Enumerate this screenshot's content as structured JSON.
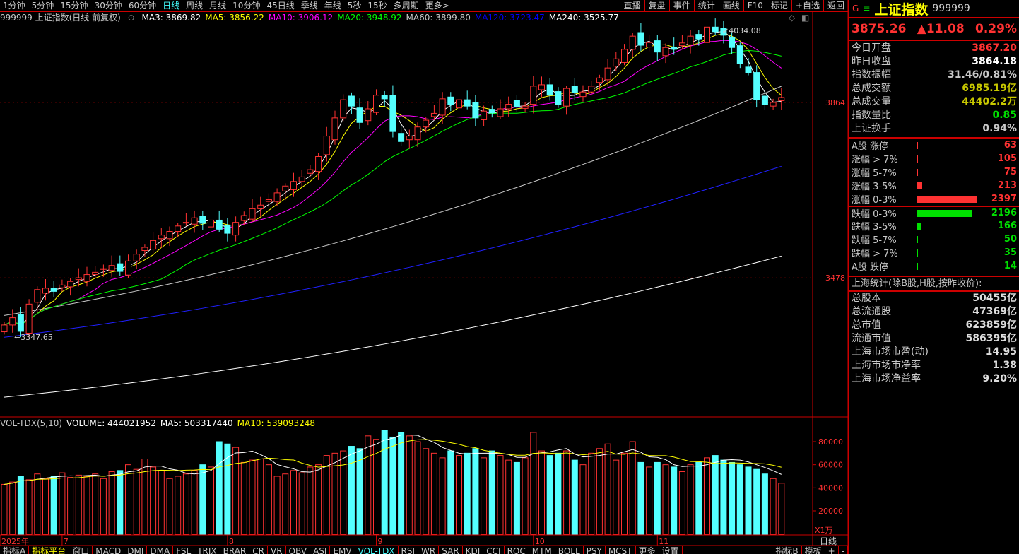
{
  "toolbar": {
    "periods": [
      "1分钟",
      "5分钟",
      "15分钟",
      "30分钟",
      "60分钟",
      "日线",
      "周线",
      "月线",
      "10分钟",
      "45日线",
      "季线",
      "年线",
      "5秒",
      "15秒",
      "多周期",
      "更多>"
    ],
    "active": "日线",
    "buttons": [
      "直播",
      "复盘",
      "事件",
      "统计",
      "画线",
      "F10",
      "标记",
      "+自选",
      "返回"
    ]
  },
  "ma_header": {
    "title": "999999 上证指数(日线 前复权)",
    "items": [
      {
        "label": "MA3: 3869.82",
        "color": "#ffffff"
      },
      {
        "label": "MA5: 3856.22",
        "color": "#ffff00"
      },
      {
        "label": "MA10: 3906.12",
        "color": "#ff00ff"
      },
      {
        "label": "MA20: 3948.92",
        "color": "#00ff00"
      },
      {
        "label": "MA60: 3899.80",
        "color": "#c8c8c8"
      },
      {
        "label": "MA120: 3723.47",
        "color": "#0000ff"
      },
      {
        "label": "MA240: 3525.77",
        "color": "#ffffff"
      }
    ]
  },
  "vol_header": {
    "items": [
      {
        "label": "VOL-TDX(5,10)",
        "color": "#c8c8c8"
      },
      {
        "label": "VOLUME: 444021952",
        "color": "#ffffff"
      },
      {
        "label": "MA5: 503317440",
        "color": "#ffffff"
      },
      {
        "label": "MA10: 539093248",
        "color": "#ffff00"
      }
    ]
  },
  "chart_data": {
    "type": "candlestick",
    "price_ticks": [
      3864,
      3478
    ],
    "high_label": "4034.08",
    "low_label": "3347.65",
    "vol_ticks": [
      80000,
      60000,
      40000,
      20000
    ],
    "vol_unit": "X1万",
    "x_labels": [
      {
        "i": 0,
        "t": "2025年"
      },
      {
        "i": 7,
        "t": "7"
      },
      {
        "i": 27,
        "t": "8"
      },
      {
        "i": 45,
        "t": "9"
      },
      {
        "i": 64,
        "t": "10"
      },
      {
        "i": 79,
        "t": "11"
      }
    ],
    "period_label": "日线",
    "closes": [
      3374,
      3390,
      3360,
      3420,
      3452,
      3455,
      3448,
      3462,
      3470,
      3478,
      3485,
      3490,
      3498,
      3505,
      3492,
      3515,
      3530,
      3545,
      3560,
      3572,
      3580,
      3592,
      3600,
      3610,
      3598,
      3605,
      3585,
      3576,
      3600,
      3615,
      3630,
      3638,
      3650,
      3665,
      3680,
      3690,
      3700,
      3716,
      3745,
      3790,
      3830,
      3870,
      3856,
      3820,
      3850,
      3880,
      3872,
      3800,
      3778,
      3790,
      3810,
      3825,
      3840,
      3872,
      3860,
      3870,
      3856,
      3830,
      3845,
      3841,
      3850,
      3860,
      3855,
      3856,
      3900,
      3903,
      3880,
      3860,
      3895,
      3885,
      3887,
      3900,
      3918,
      3940,
      3960,
      3981,
      4010,
      3990,
      3996,
      3975,
      3985,
      3981,
      3995,
      4010,
      4004,
      4030,
      4020,
      4012,
      3985,
      3950,
      3930,
      3870,
      3860,
      3864,
      3875
    ],
    "volumes": [
      43000,
      45000,
      50000,
      47000,
      52000,
      48000,
      50000,
      53000,
      49000,
      51000,
      50000,
      52000,
      48000,
      54000,
      55000,
      60000,
      56000,
      65000,
      58000,
      55000,
      48000,
      50000,
      52000,
      55000,
      60000,
      58000,
      80000,
      78000,
      75000,
      62000,
      64000,
      65000,
      60000,
      50000,
      52000,
      55000,
      53000,
      58000,
      60000,
      68000,
      70000,
      72000,
      76000,
      74000,
      85000,
      82000,
      90000,
      84000,
      88000,
      85000,
      80000,
      74000,
      70000,
      66000,
      72000,
      68000,
      70000,
      74000,
      66000,
      72000,
      68000,
      64000,
      62000,
      66000,
      88000,
      72000,
      68000,
      70000,
      72000,
      64000,
      60000,
      70000,
      74000,
      78000,
      64000,
      70000,
      80000,
      62000,
      58000,
      62000,
      60000,
      58000,
      54000,
      60000,
      62000,
      66000,
      68000,
      64000,
      62000,
      60000,
      58000,
      56000,
      52000,
      48000,
      44000
    ],
    "long_ma": [
      {
        "name": "MA60",
        "start": 3395,
        "end": 3899.8,
        "color": "#c8c8c8"
      },
      {
        "name": "MA120",
        "start": 3347,
        "end": 3723.47,
        "color": "#2020ff"
      },
      {
        "name": "MA240",
        "start": 3215,
        "end": 3525.77,
        "color": "#ffffff"
      }
    ]
  },
  "quote": {
    "name": "上证指数",
    "code": "999999",
    "price": "3875.26",
    "change": "▲11.08",
    "pct": "0.29%",
    "g": "G",
    "menu": "≡"
  },
  "stats": [
    {
      "l": "今日开盘",
      "v": "3867.20",
      "c": "#ff3232"
    },
    {
      "l": "昨日收盘",
      "v": "3864.18",
      "c": "#ffffff"
    },
    {
      "l": "指数振幅",
      "v": "31.46/0.81%",
      "c": "#c8c8c8"
    },
    {
      "l": "总成交额",
      "v": "6985.19亿",
      "c": "#c8c800"
    },
    {
      "l": "总成交量",
      "v": "44402.2万",
      "c": "#c8c800"
    },
    {
      "l": "指数量比",
      "v": "0.85",
      "c": "#00e000"
    },
    {
      "l": "上证换手",
      "v": "0.94%",
      "c": "#c8c8c8"
    }
  ],
  "breadth": [
    {
      "l": "A股 涨停",
      "v": "63",
      "c": "#ff3232",
      "w": 1
    },
    {
      "l": "涨幅 > 7%",
      "v": "105",
      "c": "#ff3232",
      "w": 1
    },
    {
      "l": "涨幅 5-7%",
      "v": "75",
      "c": "#ff3232",
      "w": 1
    },
    {
      "l": "涨幅 3-5%",
      "v": "213",
      "c": "#ff3232",
      "w": 9
    },
    {
      "l": "涨幅 0-3%",
      "v": "2397",
      "c": "#ff3232",
      "w": 100
    },
    {
      "l": "跌幅 0-3%",
      "v": "2196",
      "c": "#00e000",
      "w": 92
    },
    {
      "l": "跌幅 3-5%",
      "v": "166",
      "c": "#00e000",
      "w": 7
    },
    {
      "l": "跌幅 5-7%",
      "v": "50",
      "c": "#00e000",
      "w": 1
    },
    {
      "l": "跌幅 > 7%",
      "v": "35",
      "c": "#00e000",
      "w": 1
    },
    {
      "l": "A股 跌停",
      "v": "14",
      "c": "#00e000",
      "w": 1
    }
  ],
  "sh_title": "上海统计(除B股,H股,按昨收价):",
  "sh_stats": [
    {
      "l": "总股本",
      "v": "50455亿"
    },
    {
      "l": "总流通股",
      "v": "47369亿"
    },
    {
      "l": "总市值",
      "v": "623859亿"
    },
    {
      "l": "流通市值",
      "v": "586395亿"
    },
    {
      "l": "上海市场市盈(动)",
      "v": "14.95"
    },
    {
      "l": "上海市场市净率",
      "v": "1.38"
    },
    {
      "l": "上海市场净益率",
      "v": "9.20%"
    }
  ],
  "bottom_tabs": [
    "指标A",
    "指标平台",
    "窗口",
    "MACD",
    "DMI",
    "DMA",
    "FSL",
    "TRIX",
    "BRAR",
    "CR",
    "VR",
    "OBV",
    "ASI",
    "EMV",
    "VOL-TDX",
    "RSI",
    "WR",
    "SAR",
    "KDJ",
    "CCI",
    "ROC",
    "MTM",
    "BOLL",
    "PSY",
    "MCST",
    "更多",
    "设置"
  ],
  "bottom_active": "VOL-TDX",
  "bottom_right": [
    "指标B",
    "模板",
    "+",
    "-"
  ]
}
